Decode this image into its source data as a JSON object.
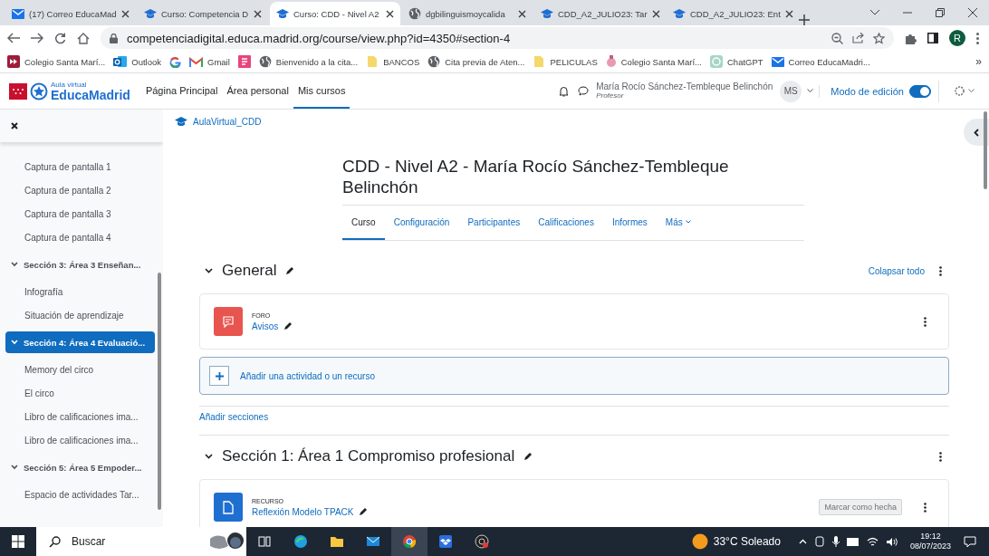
{
  "browser": {
    "tabs": [
      {
        "kind": "mail",
        "title": "(17) Correo EducaMad",
        "selected": false
      },
      {
        "kind": "course",
        "title": "Curso: Competencia D",
        "selected": false
      },
      {
        "kind": "course",
        "title": "Curso: CDD - Nivel A2",
        "selected": true
      },
      {
        "kind": "globe",
        "title": "dgbilinguismoycalida",
        "selected": false
      },
      {
        "kind": "course",
        "title": "CDD_A2_JULIO23: Tar",
        "selected": false
      },
      {
        "kind": "course",
        "title": "CDD_A2_JULIO23: Ent",
        "selected": false
      }
    ],
    "address": "competenciadigital.educa.madrid.org/course/view.php?id=4350#section-4",
    "profile_initial": "R",
    "bookmarks": [
      {
        "kind": "school",
        "label": "Colegio Santa Marí..."
      },
      {
        "kind": "outlook",
        "label": "Outlook"
      },
      {
        "kind": "google"
      },
      {
        "kind": "gmail",
        "label": "Gmail"
      },
      {
        "kind": "form"
      },
      {
        "kind": "globe",
        "label": "Bienvenido a la cita..."
      },
      {
        "kind": "folder",
        "label": "BANCOS"
      },
      {
        "kind": "globe",
        "label": "Cita previa de Aten..."
      },
      {
        "kind": "folder",
        "label": "PELICULAS"
      },
      {
        "kind": "crest",
        "label": "Colegio Santa Marí..."
      },
      {
        "kind": "chatgpt",
        "label": "ChatGPT"
      },
      {
        "kind": "mail",
        "label": "Correo EducaMadri..."
      }
    ],
    "bookmarks_more": "»"
  },
  "navbar": {
    "logo_small": "Aula virtual",
    "logo_big": "EducaMadrid",
    "links": [
      {
        "label": "Página Principal",
        "selected": false
      },
      {
        "label": "Área personal",
        "selected": false
      },
      {
        "label": "Mis cursos",
        "selected": true
      }
    ],
    "user_name": "María Rocío Sánchez-Tembleque Belinchón",
    "user_role": "Profesor",
    "user_initials": "MS",
    "edit_mode": {
      "label": "Modo de edición",
      "on": true
    }
  },
  "course_index": {
    "items": [
      {
        "kind": "item",
        "label": "Captura de pantalla 1"
      },
      {
        "kind": "item",
        "label": "Captura de pantalla 2"
      },
      {
        "kind": "item",
        "label": "Captura de pantalla 3"
      },
      {
        "kind": "item",
        "label": "Captura de pantalla 4"
      },
      {
        "kind": "section",
        "label": "Sección 3: Área 3 Enseñan...",
        "expanded": true,
        "selected": false,
        "children": [
          {
            "label": "Infografía"
          },
          {
            "label": "Situación de aprendizaje"
          }
        ]
      },
      {
        "kind": "section",
        "label": "Sección 4: Área 4 Evaluació...",
        "expanded": true,
        "selected": true,
        "children": [
          {
            "label": "Memory del circo"
          },
          {
            "label": "El circo"
          },
          {
            "label": "Libro de calificaciones ima..."
          },
          {
            "label": "Libro de calificaciones ima..."
          }
        ]
      },
      {
        "kind": "section",
        "label": "Sección 5: Área 5 Empoder...",
        "expanded": true,
        "selected": false,
        "children": [
          {
            "label": "Espacio de actividades Tar..."
          }
        ]
      }
    ]
  },
  "breadcrumb": "AulaVirtual_CDD",
  "course_title": "CDD - Nivel A2 - María Rocío Sánchez-Tembleque Belinchón",
  "course_tabs": [
    {
      "label": "Curso",
      "selected": true
    },
    {
      "label": "Configuración",
      "selected": false
    },
    {
      "label": "Participantes",
      "selected": false
    },
    {
      "label": "Calificaciones",
      "selected": false
    },
    {
      "label": "Informes",
      "selected": false
    },
    {
      "label": "Más",
      "selected": false
    }
  ],
  "collapse_all": "Colapsar todo",
  "add_sections": "Añadir secciones",
  "sections": [
    {
      "title": "General",
      "expanded": true,
      "activities": [
        {
          "kind": "forum",
          "type_label": "FORO",
          "name": "Avisos"
        }
      ],
      "add_activity": "Añadir una actividad o un recurso"
    },
    {
      "title": "Sección 1: Área 1 Compromiso profesional",
      "expanded": true,
      "activities": [
        {
          "kind": "resource",
          "type_label": "RECURSO",
          "name": "Reflexión Modelo TPACK",
          "completion_button": "Marcar como hecha"
        }
      ]
    }
  ],
  "taskbar": {
    "search_placeholder": "Buscar",
    "weather": "33°C Soleado",
    "time": "19:12",
    "date": "08/07/2023"
  }
}
